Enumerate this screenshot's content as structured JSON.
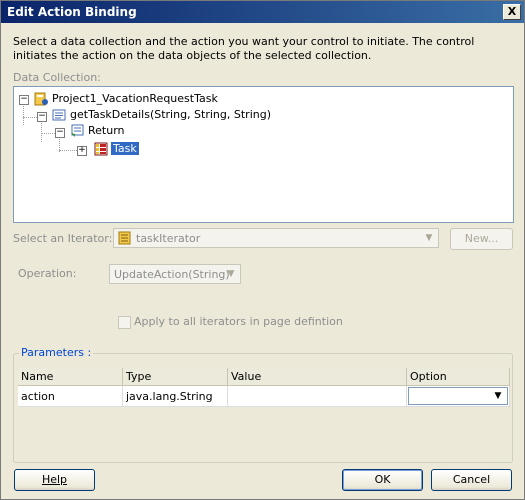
{
  "window": {
    "title": "Edit Action Binding",
    "close_glyph": "X"
  },
  "description": "Select a data collection and the action you want your control to initiate. The control initiates the action on the data objects of the selected collection.",
  "data_collection": {
    "label": "Data Collection:",
    "tree": [
      {
        "label": "Project1_VacationRequestTask",
        "icon": "data-control-icon",
        "expanded": true,
        "selected": false
      },
      {
        "label": "getTaskDetails(String, String, String)",
        "icon": "method-icon",
        "expanded": true,
        "selected": false
      },
      {
        "label": "Return",
        "icon": "return-icon",
        "expanded": true,
        "selected": false
      },
      {
        "label": "Task",
        "icon": "collection-icon",
        "expanded": false,
        "selected": true
      }
    ]
  },
  "iterator": {
    "label": "Select an Iterator:",
    "value": "taskIterator",
    "icon": "iterator-icon",
    "new_button": "New..."
  },
  "operation": {
    "label": "Operation:",
    "value": "UpdateAction(String)"
  },
  "apply_all": {
    "label": "Apply to all iterators in page defintion",
    "checked": false
  },
  "parameters": {
    "label": "Parameters :",
    "columns": [
      "Name",
      "Type",
      "Value",
      "Option"
    ],
    "rows": [
      {
        "name": "action",
        "type": "java.lang.String",
        "value": "",
        "option": ""
      }
    ]
  },
  "buttons": {
    "help": "Help",
    "ok": "OK",
    "cancel": "Cancel"
  },
  "colors": {
    "title_bar": "#0a246a",
    "selection": "#316ac5",
    "group_label": "#0046d5",
    "dialog_bg": "#ece9d8"
  }
}
